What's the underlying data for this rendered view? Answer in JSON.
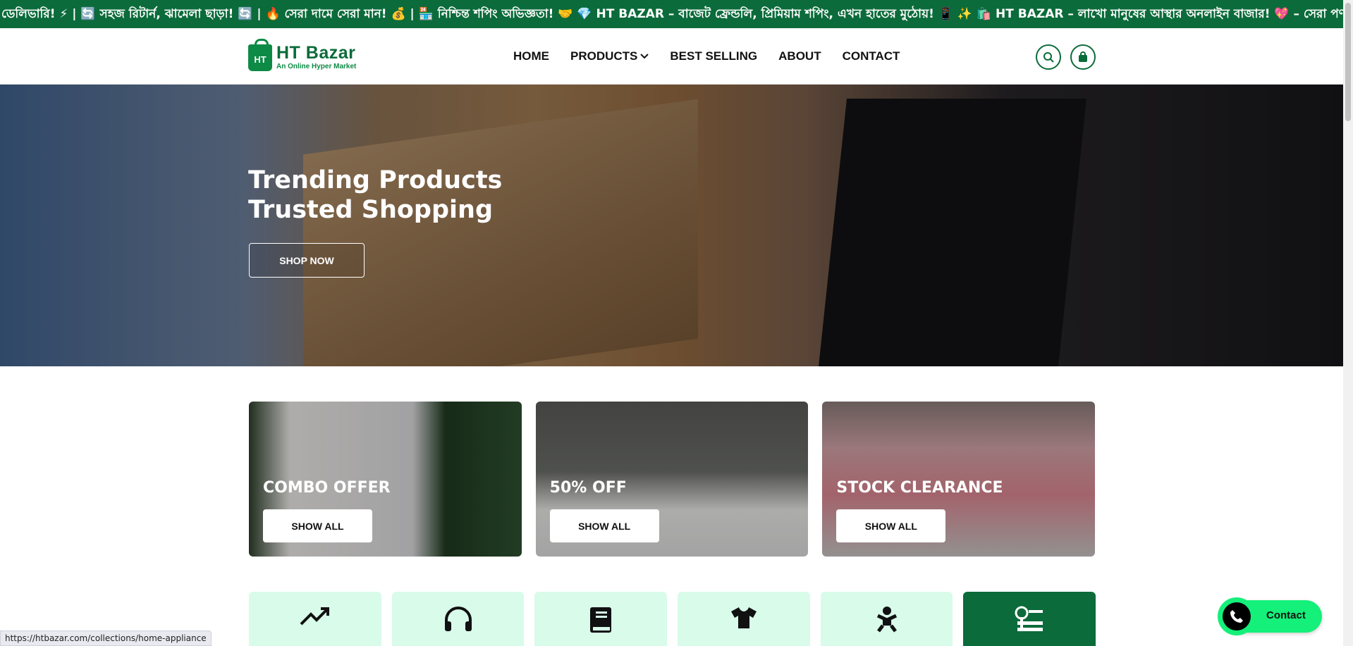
{
  "ticker": {
    "text": "ডেলিভারি! ⚡ | 🔄 সহজ রিটার্ন, ঝামেলা ছাড়া! 🔄 | 🔥 সেরা দামে সেরা মান! 💰 | 🏪 নিশ্চিন্ত শপিং অভিজ্ঞতা! 🤝 💎 HT BAZAR – বাজেট ফ্রেন্ডলি, প্রিমিয়াম শপিং, এখন হাতের মুঠোয়! 📱 ✨      🛍️ HT BAZAR – লাখো মানুষের আস্থার অনলাইন বাজার! 💖 – সেরা পণ্য, সেরা দাম, সেরা ডেলিভারি"
  },
  "header": {
    "logo_brand": "HT Bazar",
    "logo_tagline": "An Online Hyper Market",
    "logo_badge": "HT",
    "nav": {
      "home": "HOME",
      "products": "PRODUCTS",
      "best_selling": "BEST SELLING",
      "about": "ABOUT",
      "contact": "CONTACT"
    },
    "icons": [
      "search-icon",
      "shopping-bag-icon"
    ]
  },
  "hero": {
    "line1": "Trending Products",
    "line2": "Trusted Shopping",
    "cta": "SHOP NOW"
  },
  "promos": [
    {
      "title": "COMBO OFFER",
      "button": "SHOW ALL"
    },
    {
      "title": "50% OFF",
      "button": "SHOW ALL"
    },
    {
      "title": "STOCK CLEARANCE",
      "button": "SHOW ALL"
    }
  ],
  "categories": [
    {
      "icon": "trending-up-icon",
      "active": false
    },
    {
      "icon": "headphones-icon",
      "active": false
    },
    {
      "icon": "book-icon",
      "active": false
    },
    {
      "icon": "tshirt-icon",
      "active": false
    },
    {
      "icon": "baby-icon",
      "active": false
    },
    {
      "icon": "home-appliance-icon",
      "active": true
    }
  ],
  "status_bar": {
    "url": "https://htbazar.com/collections/home-appliance"
  },
  "contact_widget": {
    "label": "Contact"
  },
  "colors": {
    "brand_green": "#0b6b3a",
    "category_bg": "#d8fbea",
    "contact_green": "#14f07a"
  }
}
